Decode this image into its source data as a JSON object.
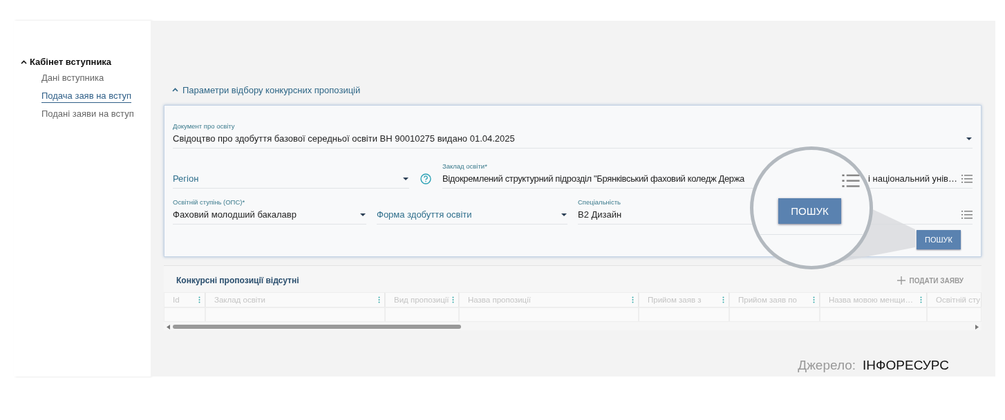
{
  "sidebar": {
    "title": "Кабінет вступника",
    "expanded": true,
    "items": [
      {
        "label": "Дані вступника",
        "selected": false
      },
      {
        "label": "Подача заяв на вступ",
        "selected": true
      },
      {
        "label": "Подані заяви на вступ",
        "selected": false
      }
    ]
  },
  "filter_section": {
    "title": "Параметри відбору конкурсних пропозицій",
    "expanded": true,
    "document": {
      "label": "Документ про освіту",
      "value": "Свідоцтво про здобуття базової середньої освіти ВН 90010275 видано 01.04.2025"
    },
    "region": {
      "placeholder": "Регіон"
    },
    "institution": {
      "label": "Заклад освіти*",
      "value_start": "Відокремлений структурний підрозділ \"Брянківський фаховий коледж Держа",
      "value_end": "і національний унів…"
    },
    "degree": {
      "label": "Освітній ступінь (ОПС)*",
      "value": "Фаховий молодший бакалавр"
    },
    "study_form": {
      "placeholder": "Форма здобуття освіти"
    },
    "specialty": {
      "label": "Спеціальність",
      "value": "В2 Дизайн"
    },
    "search_button": "ПОШУК"
  },
  "results": {
    "title": "Конкурсні пропозиції відсутні",
    "add_button": "ПОДАТИ ЗАЯВУ",
    "table": {
      "columns": [
        "Id",
        "Заклад освіти",
        "Вид пропозиції",
        "Назва пропозиції",
        "Прийом заяв з",
        "Прийом заяв по",
        "Назва мовою менщи…",
        "Освітній сту"
      ]
    }
  },
  "magnifier": {
    "button": "ПОШУК"
  },
  "source": {
    "label": "Джерело:",
    "value": "ІНФОРЕСУРС"
  }
}
